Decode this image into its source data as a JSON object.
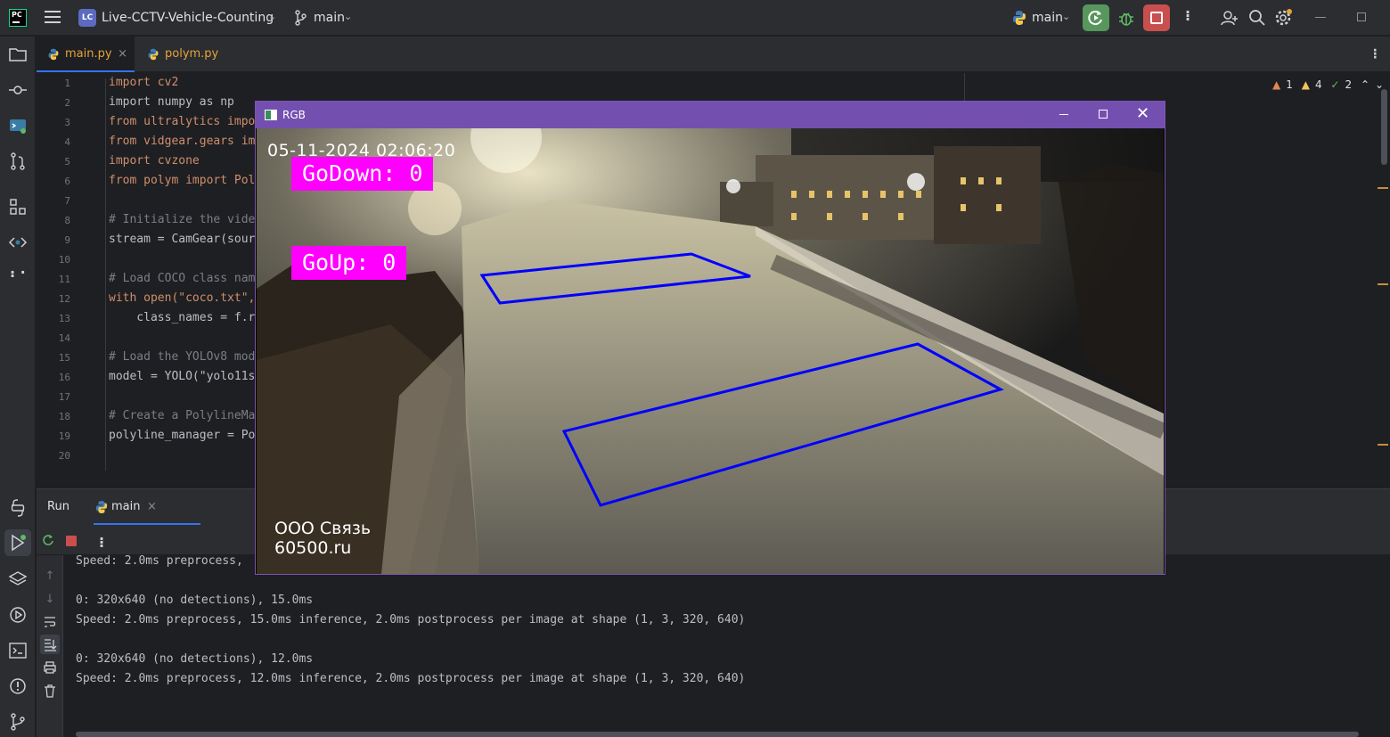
{
  "titlebar": {
    "logo_text": "PC",
    "project_badge": "LC",
    "project_name": "Live-CCTV-Vehicle-Counting",
    "vcs_branch": "main",
    "run_config": "main"
  },
  "editor": {
    "tabs": [
      {
        "label": "main.py",
        "active": true,
        "closable": true
      },
      {
        "label": "polym.py",
        "active": false,
        "closable": false
      }
    ],
    "line_numbers": [
      "1",
      "2",
      "3",
      "4",
      "5",
      "6",
      "7",
      "8",
      "9",
      "10",
      "11",
      "12",
      "13",
      "14",
      "15",
      "16",
      "17",
      "18",
      "19",
      "20"
    ],
    "code_lines": [
      "import cv2",
      "import numpy as np",
      "from ultralytics impo",
      "from vidgear.gears im",
      "import cvzone",
      "from polym import Pol",
      "",
      "# Initialize the vide",
      "stream = CamGear(sour",
      "",
      "# Load COCO class nam",
      "with open(\"coco.txt\",",
      "    class_names = f.r",
      "",
      "# Load the YOLOv8 mod",
      "model = YOLO(\"yolo11s",
      "",
      "# Create a PolylineMa",
      "polyline_manager = Po",
      ""
    ],
    "inspections": {
      "errors": "1",
      "warnings": "4",
      "ok": "2"
    }
  },
  "run_panel": {
    "title": "Run",
    "tab_label": "main",
    "console_lines": [
      "Speed: 2.0ms preprocess,",
      "",
      "0: 320x640 (no detections), 15.0ms",
      "Speed: 2.0ms preprocess, 15.0ms inference, 2.0ms postprocess per image at shape (1, 3, 320, 640)",
      "",
      "0: 320x640 (no detections), 12.0ms",
      "Speed: 2.0ms preprocess, 12.0ms inference, 2.0ms postprocess per image at shape (1, 3, 320, 640)"
    ]
  },
  "cv_window": {
    "title": "RGB",
    "timestamp": "05-11-2024 02:06:20",
    "go_down": "GoDown: 0",
    "go_up": "GoUp: 0",
    "watermark_line1": "ООО Связь",
    "watermark_line2": "60500.ru"
  },
  "colors": {
    "accent": "#3574f0",
    "rerun_green": "#57965c",
    "stop_red": "#c94f4f",
    "cv_titlebar": "#7350b0",
    "counter_magenta": "#ff00ff",
    "zone_blue": "#0000ff"
  }
}
